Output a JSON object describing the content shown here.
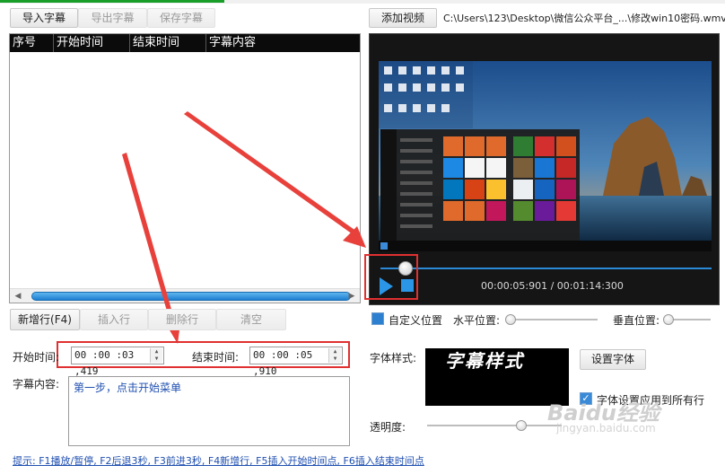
{
  "toolbar": {
    "import_label": "导入字幕",
    "export_label": "导出字幕",
    "save_label": "保存字幕"
  },
  "video": {
    "add_label": "添加视频",
    "file_path": "C:\\Users\\123\\Desktop\\微信公众平台_...\\修改win10密码.wmv",
    "timecode": "00:00:05:901 / 00:01:14:300"
  },
  "table": {
    "columns": [
      "序号",
      "开始时间",
      "结束时间",
      "字幕内容"
    ]
  },
  "row_actions": {
    "new_row": "新增行(F4)",
    "insert_row": "插入行",
    "delete_row": "删除行",
    "clear": "清空"
  },
  "position": {
    "custom_label": "自定义位置",
    "horizontal_label": "水平位置:",
    "vertical_label": "垂直位置:"
  },
  "editor": {
    "start_label": "开始时间:",
    "start_value": "00 :00 :03 ,419",
    "end_label": "结束时间:",
    "end_value": "00 :00 :05 ,910",
    "content_label": "字幕内容:",
    "content_value": "第一步，点击开始菜单"
  },
  "font": {
    "style_label": "字体样式:",
    "preview_text": "字幕样式",
    "set_font_label": "设置字体",
    "apply_all_label": "字体设置应用到所有行",
    "apply_all_checked": true
  },
  "opacity": {
    "label": "透明度:",
    "value_fraction": 0.7
  },
  "hint": "提示: F1播放/暂停, F2后退3秒, F3前进3秒, F4新增行, F5插入开始时间点, F6插入结束时间点",
  "watermark": {
    "brand": "Baidu经验",
    "url": "jingyan.baidu.com"
  },
  "colors": {
    "accent_blue": "#2b95e6",
    "annotation_red": "#e03030",
    "hint_blue": "#1f4fb0"
  }
}
